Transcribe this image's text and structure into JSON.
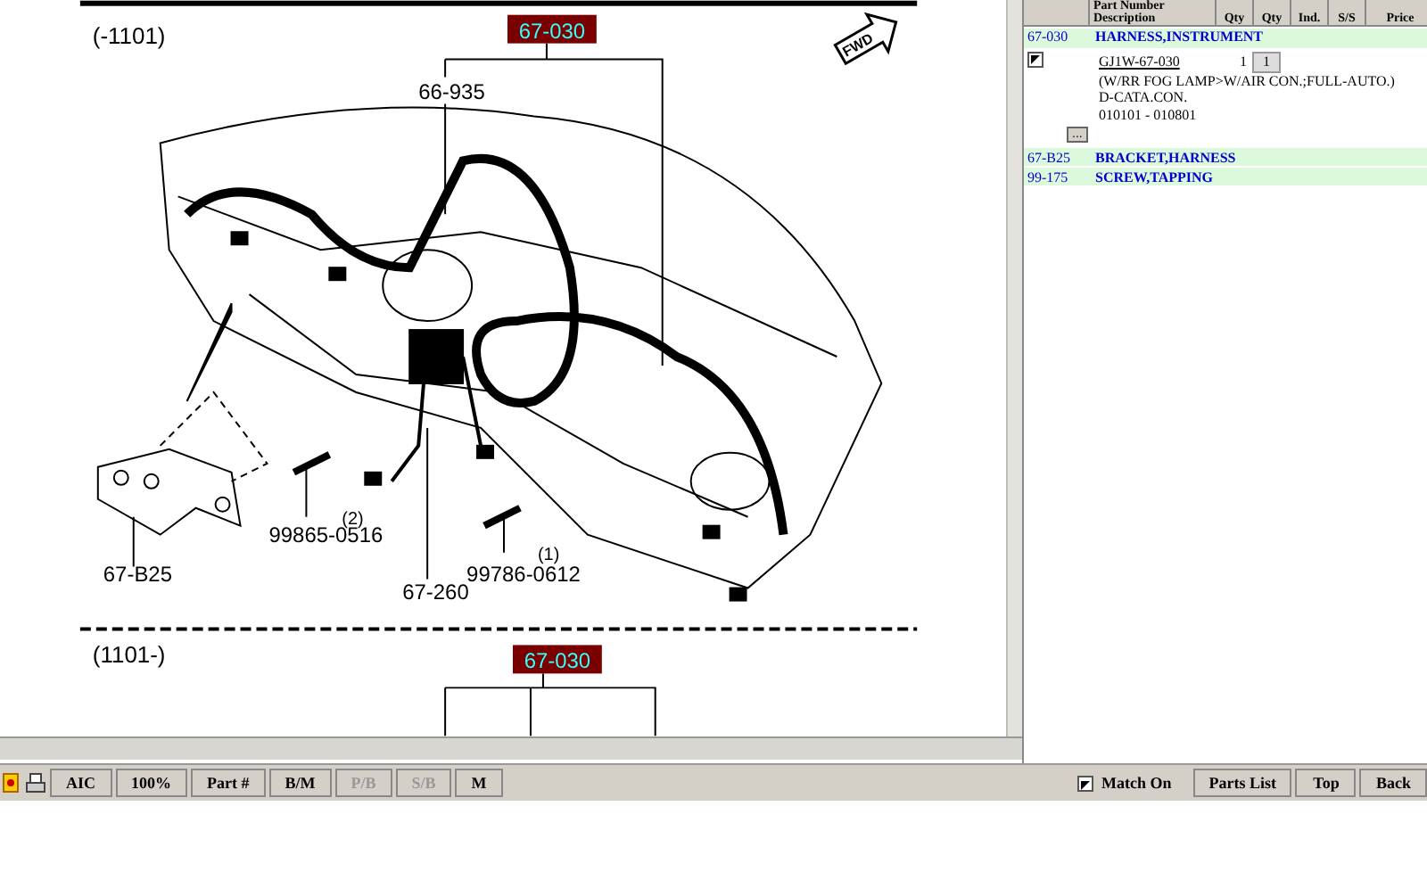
{
  "diagram": {
    "upper": {
      "range": "(-1101)",
      "ref_label": "67-030",
      "callouts": [
        "66-935",
        "67-B25",
        "99865-0516",
        "(2)",
        "67-260",
        "99786-0612",
        "(1)"
      ]
    },
    "lower": {
      "range": "(1101-)",
      "ref_label": "67-030"
    },
    "fwd_label": "FWD"
  },
  "parts_list": {
    "columns": [
      "Part Number",
      "Description",
      "Qty",
      "Qty",
      "Ind.",
      "S/S",
      "Price"
    ],
    "rows": [
      {
        "ref": "67-030",
        "description": "HARNESS,INSTRUMENT",
        "expanded": true,
        "checked": true,
        "part_no": "GJ1W-67-030",
        "qty": "1",
        "order_qty": "1",
        "remarks": [
          "(W/RR FOG LAMP>W/AIR CON.;FULL-AUTO.)",
          "D-CATA.CON.",
          "010101  - 010801"
        ],
        "more": "..."
      },
      {
        "ref": "67-B25",
        "description": "BRACKET,HARNESS",
        "expanded": false
      },
      {
        "ref": "99-175",
        "description": "SCREW,TAPPING",
        "expanded": false
      }
    ]
  },
  "toolbar": {
    "buttons": [
      {
        "kind": "help"
      },
      {
        "kind": "print"
      },
      {
        "kind": "text",
        "label": "AIC",
        "disabled": false
      },
      {
        "kind": "zoom",
        "label": "100%",
        "disabled": false
      },
      {
        "kind": "text",
        "label": "Part #",
        "disabled": false
      },
      {
        "kind": "text",
        "label": "B/M",
        "disabled": false
      },
      {
        "kind": "text",
        "label": "P/B",
        "disabled": true
      },
      {
        "kind": "text",
        "label": "S/B",
        "disabled": true
      },
      {
        "kind": "text",
        "label": "M",
        "disabled": false
      }
    ],
    "match_on": {
      "label": "Match On",
      "checked": true
    },
    "nav_buttons": [
      "Parts List",
      "Top",
      "Back"
    ]
  }
}
